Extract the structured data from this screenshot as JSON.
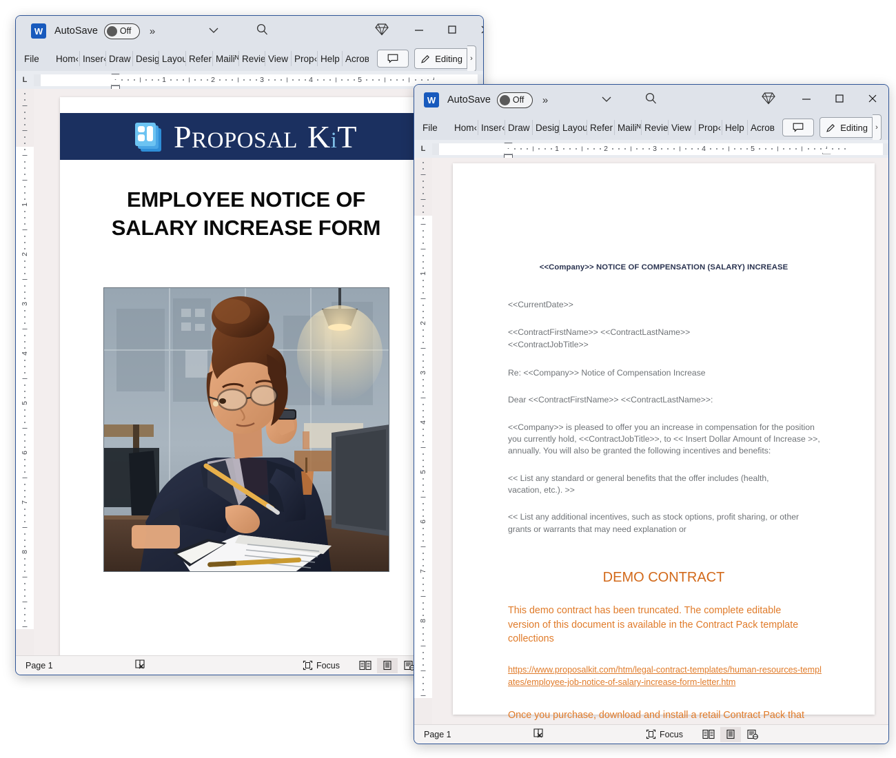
{
  "app": {
    "name": "Microsoft Word",
    "logo_letter": "W",
    "autosave_label": "AutoSave",
    "autosave_state": "Off",
    "overflow_chevron": "»",
    "qat_caret": "⌄",
    "search_icon": "search-icon",
    "gem_icon": "diamond-icon",
    "minimize": "─",
    "maximize": "□",
    "close": "✕"
  },
  "ribbon": {
    "tabs": [
      "File",
      "Hom‹",
      "Inser‹",
      "Draw",
      "Desiɡ",
      "Layoᴜ",
      "Refer",
      "Mailiᴺ",
      "Revie",
      "View",
      "Prop‹",
      "Help",
      "Acroʙ"
    ],
    "comment_button": "comment-icon",
    "editing_label": "Editing",
    "editing_icon": "pencil-icon",
    "expand_chevron": "›"
  },
  "ruler": {
    "tabstop_marker": "L",
    "numbers": [
      "1",
      "2",
      "3",
      "4",
      "5"
    ]
  },
  "vruler": {
    "numbers": [
      "1",
      "2",
      "3",
      "4",
      "5",
      "6",
      "7",
      "8"
    ]
  },
  "statusbar": {
    "page": "Page 1",
    "proofing_icon": "proofing-errors-icon",
    "focus_label": "Focus",
    "focus_icon": "focus-icon",
    "views": [
      {
        "name": "read-mode-view",
        "icon": "book-icon",
        "active": false
      },
      {
        "name": "print-layout-view",
        "icon": "page-icon",
        "active": true
      },
      {
        "name": "web-layout-view",
        "icon": "web-page-icon",
        "active": false
      }
    ]
  },
  "window1": {
    "document": {
      "banner": {
        "brand_part1": "P",
        "brand_rest1": "ROPOSAL",
        "brand_part2": "K",
        "brand_i": "i",
        "brand_t": "T",
        "brand_full": "Proposal Kit",
        "bg_color": "#1b3060",
        "icon_name": "proposal-kit-logo-icon"
      },
      "title_line1": "EMPLOYEE NOTICE OF",
      "title_line2": "SALARY INCREASE FORM",
      "image_alt": "Illustration of a businesswoman in a dark blazer with glasses writing on documents at a desk beside a laptop, office window behind her"
    }
  },
  "window2": {
    "document": {
      "heading_field": "<<Company>>",
      "heading_rest": " NOTICE OF COMPENSATION (SALARY) INCREASE",
      "paragraphs": [
        "<<CurrentDate>>",
        "<<ContractFirstName>> <<ContractLastName>>\n<<ContractJobTitle>>",
        "Re: <<Company>> Notice of Compensation Increase",
        "Dear <<ContractFirstName>> <<ContractLastName>>:",
        "<<Company>> is pleased to offer you an increase in compensation for the position you currently hold, <<ContractJobTitle>>, to << Insert Dollar Amount of Increase >>, annually. You will also be granted the following incentives and benefits:",
        "<< List any standard or general benefits that the offer includes (health, vacation, etc.). >>",
        "<< List any additional incentives, such as stock options, profit sharing, or other grants or warrants that may need explanation or"
      ],
      "demo_title": "DEMO CONTRACT",
      "demo_para1": "This demo contract has been truncated. The complete editable version of this document is available in the Contract Pack template collections",
      "demo_link": "https://www.proposalkit.com/htm/legal-contract-templates/human-resources-templates/employee-job-notice-of-salary-increase-form-letter.htm",
      "demo_para2": "Once you purchase, download and install a retail Contract Pack that includes this contract, the complete version of this contract will be inserted into your project.",
      "colors": {
        "heading": "#2a3350",
        "body": "#6f7377",
        "accent_orange": "#e07b2a",
        "demo_title_orange": "#d2691a"
      }
    }
  }
}
